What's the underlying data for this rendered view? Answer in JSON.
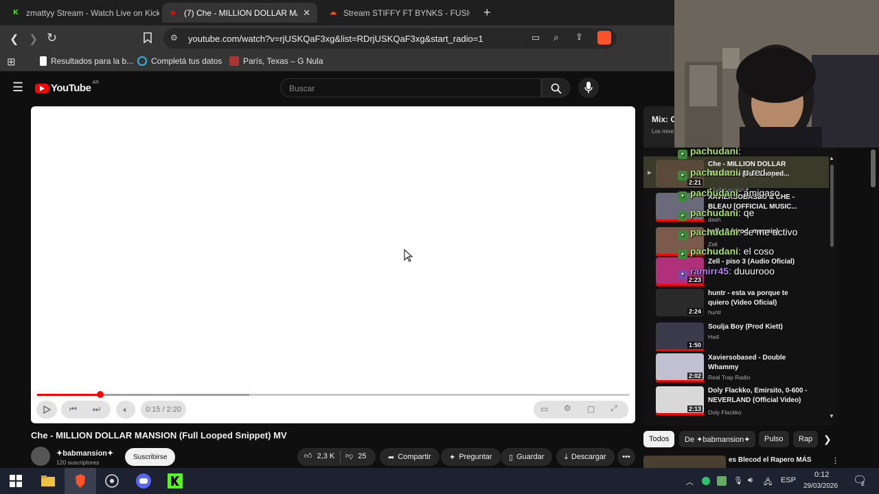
{
  "browser": {
    "tabs": [
      {
        "label": "zmattyy Stream - Watch Live on Kick",
        "favicon": "K",
        "favicon_color": "#53fc18",
        "active": false
      },
      {
        "label": "(7) Che - MILLION DOLLAR MAN",
        "favicon": "▶",
        "favicon_color": "#ff0000",
        "active": true
      },
      {
        "label": "Stream STIFFY FT BYNKS - FUSION AR",
        "favicon": "☁",
        "favicon_color": "#ff5500",
        "active": false
      }
    ],
    "url": "youtube.com/watch?v=rjUSKQaF3xg&list=RDrjUSKQaF3xg&start_radio=1",
    "bookmarks": [
      {
        "label": "Resultados para la b..."
      },
      {
        "label": "Completá tus datos"
      },
      {
        "label": "París, Texas – G Nula"
      }
    ]
  },
  "youtube": {
    "logo": "YouTube",
    "region": "AR",
    "search_placeholder": "Buscar"
  },
  "player": {
    "time": "0:15 / 2:20",
    "progress": 0.107,
    "buffered": 0.358
  },
  "video": {
    "title": "Che - MILLION DOLLAR MANSION (Full Looped Snippet) MV",
    "channel": "✦babmansion✦",
    "subscribers": "120 suscriptores",
    "subscribe_label": "Suscribirse",
    "likes": "2,3 K",
    "dislikes": "25",
    "share": "Compartir",
    "ask": "Preguntar",
    "save": "Guardar",
    "download": "Descargar"
  },
  "playlist": {
    "title": "Mix: C",
    "subtitle": "Los mixe",
    "items": [
      {
        "title": "Che - MILLION DOLLAR MANSION (Full Looped...",
        "channel": "✦babmansion✦",
        "duration": "2:21",
        "thumb": "#5a4a3a"
      },
      {
        "title": "XAVIERSOBASED & CHE - BLEAU [OFFICIAL MUSIC...",
        "channel": "dash",
        "duration": "",
        "thumb": "#6a6a7a"
      },
      {
        "title": "zell - 3 (prod. mannie)",
        "channel": "Zell",
        "duration": "",
        "thumb": "#7a5a4a"
      },
      {
        "title": "Zell - piso 3 (Audio Oficial)",
        "channel": "",
        "duration": "2:23",
        "thumb": "#b0307a"
      },
      {
        "title": "huntr - esta va porque te quiero (Video Oficial)",
        "channel": "huntr",
        "duration": "2:24",
        "thumb": "#2a2a2a"
      },
      {
        "title": "Soulja Boy (Prod Kiett)",
        "channel": "Hwil",
        "duration": "1:50",
        "thumb": "#3a3a4a"
      },
      {
        "title": "Xaviersobased - Double Whammy",
        "channel": "Real Trap Radio",
        "duration": "2:02",
        "thumb": "#c0c0d0"
      },
      {
        "title": "Doly Flackko, Emirsito, 0-600 - NEVERLAND (Official Video)",
        "channel": "Doly Flackko",
        "duration": "2:13",
        "thumb": "#d8d8d8"
      }
    ]
  },
  "chips": [
    "Todos",
    "De ✦babmansion✦",
    "Pulso",
    "Rap"
  ],
  "recommendation": {
    "title": "es Blecod el Rapero MÁS"
  },
  "chat": [
    {
      "user": "pachudani",
      "text": ""
    },
    {
      "user": "pachudani",
      "text": "u red..."
    },
    {
      "user": "pachudani",
      "text": "amigaso"
    },
    {
      "user": "pachudani",
      "text": "qe"
    },
    {
      "user": "pachudani",
      "text": "se me activo"
    },
    {
      "user": "pachudani",
      "text": "el coso"
    },
    {
      "user": "ramirr45",
      "text": "duuurooo"
    }
  ],
  "taskbar": {
    "lang": "ESP",
    "time": "0:12",
    "date": "29/03/2026",
    "notifications": "2"
  }
}
